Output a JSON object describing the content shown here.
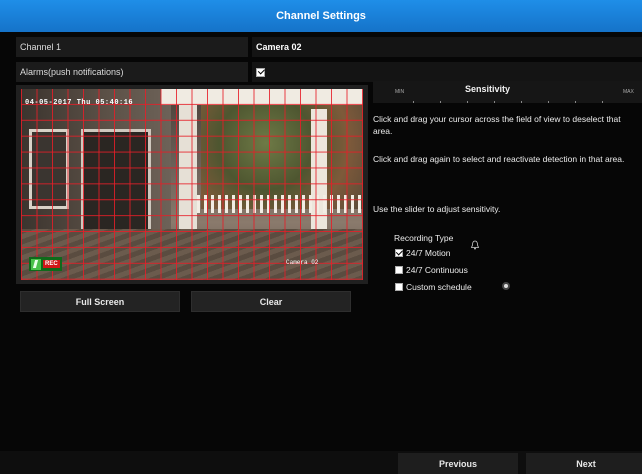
{
  "window": {
    "title": "Channel Settings"
  },
  "fields": [
    {
      "label": "Channel 1",
      "value": "Camera 02"
    },
    {
      "label": "Alarms(push notifications)",
      "checked": true
    }
  ],
  "video": {
    "timestamp": "04-05-2017  Thu 05:40:16",
    "camera_osd": "Camera 02",
    "rec_label": "REC",
    "grid_color": "#e61e28"
  },
  "buttons": {
    "full_screen": "Full Screen",
    "clear": "Clear"
  },
  "sensitivity": {
    "title": "Sensitivity",
    "min_label": "MIN",
    "max_label": "MAX"
  },
  "instructions": [
    "Click and drag your cursor across the field of view to deselect that area.",
    "Click and drag again to select and reactivate detection in that area.",
    "Use the slider to adjust sensitivity."
  ],
  "recording": {
    "title": "Recording Type",
    "options": [
      {
        "label": "24/7 Motion",
        "checked": true
      },
      {
        "label": "24/7 Continuous",
        "checked": false
      },
      {
        "label": "Custom schedule",
        "checked": false
      }
    ]
  },
  "footer": {
    "previous": "Previous",
    "next": "Next"
  },
  "colors": {
    "accent": "#1a82dc",
    "background": "#060606"
  }
}
